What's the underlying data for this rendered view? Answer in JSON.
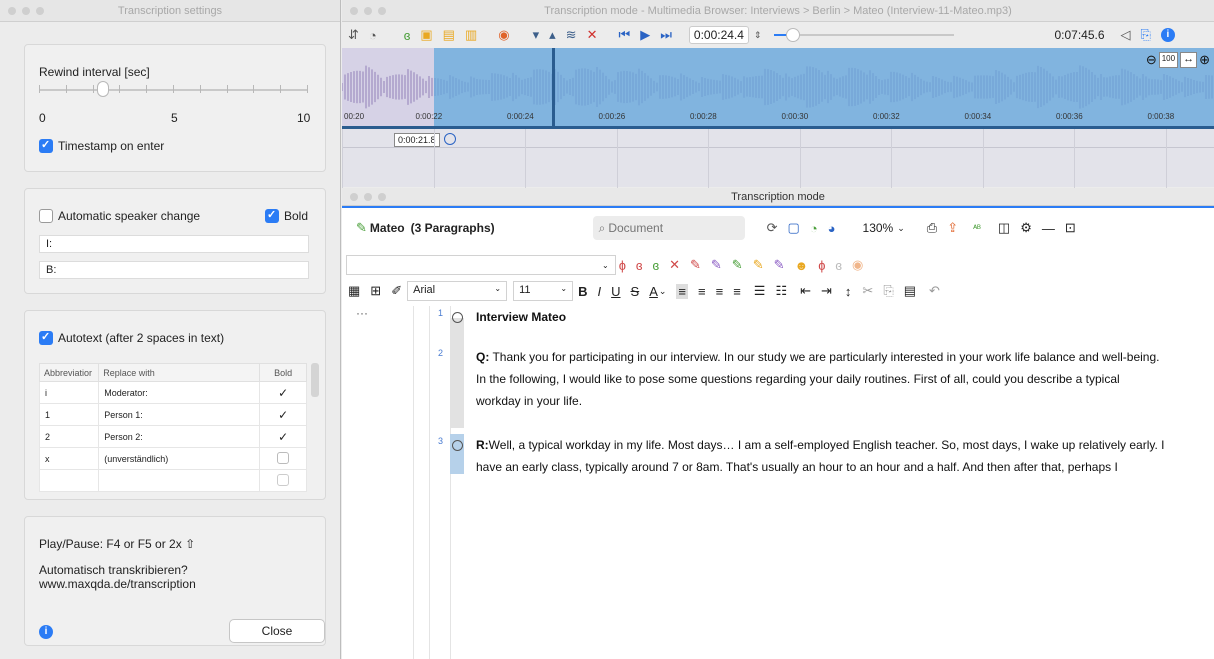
{
  "settings": {
    "title": "Transcription settings",
    "rewind_label": "Rewind interval [sec]",
    "rewind_scale": [
      "0",
      "5",
      "10"
    ],
    "rewind_value": 1.5,
    "timestamp_label": "Timestamp on enter",
    "speaker_change_label": "Automatic speaker change",
    "bold_label": "Bold",
    "speaker_fields": [
      "I:",
      "B:"
    ],
    "autotext_label": "Autotext (after 2 spaces in text)",
    "table_headers": [
      "Abbreviatior",
      "Replace with",
      "Bold"
    ],
    "table_rows": [
      {
        "abbr": "i",
        "replace": "Moderator:",
        "bold": true
      },
      {
        "abbr": "1",
        "replace": "Person 1:",
        "bold": true
      },
      {
        "abbr": "2",
        "replace": "Person 2:",
        "bold": true
      },
      {
        "abbr": "x",
        "replace": "(unverständlich)",
        "bold": false
      }
    ],
    "playpause_text": "Play/Pause: F4 or F5 or 2x ⇧",
    "auto_text": "Automatisch transkribieren?",
    "auto_url": "www.maxqda.de/transcription",
    "close_label": "Close"
  },
  "media": {
    "title": "Transcription mode - Multimedia Browser: Interviews > Berlin > Mateo (Interview-11-Mateo.mp3)",
    "current_time": "0:00:24.4",
    "total_time": "0:07:45.6",
    "ruler_ticks": [
      "00:20",
      "0:00:22",
      "0:00:24",
      "0:00:26",
      "0:00:28",
      "0:00:30",
      "0:00:32",
      "0:00:34",
      "0:00:36",
      "0:00:38"
    ],
    "marker_time": "0:00:21.8",
    "zoom_label": "100"
  },
  "transcript": {
    "window_title": "Transcription mode",
    "doc_title": "Mateo",
    "paragraph_count": "(3 Paragraphs)",
    "search_placeholder": "Document",
    "zoom": "130%",
    "font": "Arial",
    "font_size": "11",
    "ellipsis": "···",
    "paragraphs": [
      {
        "num": "1",
        "lines": [
          "Interview Mateo"
        ],
        "bold_prefix": ""
      },
      {
        "num": "2",
        "bold_prefix": "Q:",
        "lines": [
          " Thank you for participating in our interview. In our study we are particularly interested in your work life balance and well-being.",
          "In the following, I would like to pose some questions regarding your daily routines. First of all, could you describe a typical",
          "workday in your life."
        ]
      },
      {
        "num": "3",
        "bold_prefix": "R:",
        "lines": [
          "Well, a typical workday in my life. Most days… I am a self-employed English teacher. So, most days, I wake up relatively early. I",
          "have an early class, typically around 7 or 8am. That's usually an hour to an hour and a half. And then after that, perhaps I"
        ]
      }
    ]
  }
}
